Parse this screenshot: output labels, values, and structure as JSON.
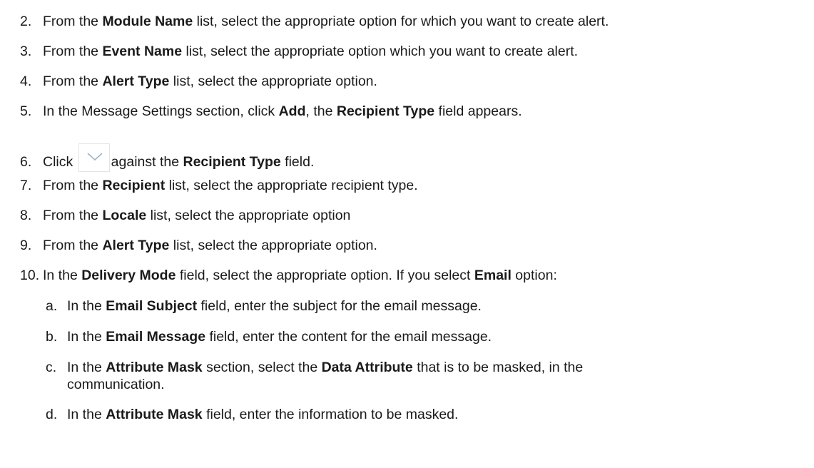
{
  "steps": [
    {
      "num": "2.",
      "parts": [
        "From the ",
        "Module Name",
        " list, select the appropriate option for which you want to create alert."
      ]
    },
    {
      "num": "3.",
      "parts": [
        "From the ",
        "Event Name",
        " list, select the appropriate option which you want to create alert."
      ]
    },
    {
      "num": "4.",
      "parts": [
        "From the ",
        "Alert Type",
        " list, select the appropriate option."
      ]
    },
    {
      "num": "5.",
      "parts": [
        "In the Message Settings section, click ",
        "Add",
        ", the ",
        "Recipient Type",
        " field appears."
      ]
    },
    {
      "num": "6.",
      "parts": [
        "Click ",
        "against the ",
        "Recipient Type",
        " field."
      ],
      "icon": "chevron-down-icon"
    },
    {
      "num": "7.",
      "parts": [
        "From the ",
        "Recipient",
        " list, select the appropriate recipient type."
      ]
    },
    {
      "num": "8.",
      "parts": [
        "From the ",
        "Locale",
        " list, select the appropriate option"
      ]
    },
    {
      "num": "9.",
      "parts": [
        "From the ",
        "Alert Type",
        " list, select the appropriate option."
      ]
    },
    {
      "num": "10.",
      "parts": [
        "In the ",
        "Delivery Mode",
        " field, select the appropriate option. If you select ",
        "Email",
        " option:"
      ]
    }
  ],
  "substeps": [
    {
      "num": "a.",
      "parts": [
        "In the ",
        "Email Subject",
        " field, enter the subject for the email message."
      ]
    },
    {
      "num": "b.",
      "parts": [
        "In the ",
        "Email Message",
        " field, enter the content for the email message."
      ]
    },
    {
      "num": "c.",
      "parts": [
        "In the ",
        "Attribute Mask",
        " section, select the ",
        "Data Attribute",
        " that is to be masked, in the"
      ],
      "continuation": "communication."
    },
    {
      "num": "d.",
      "parts": [
        "In the ",
        "Attribute Mask",
        " field, enter the information to be masked."
      ]
    }
  ]
}
